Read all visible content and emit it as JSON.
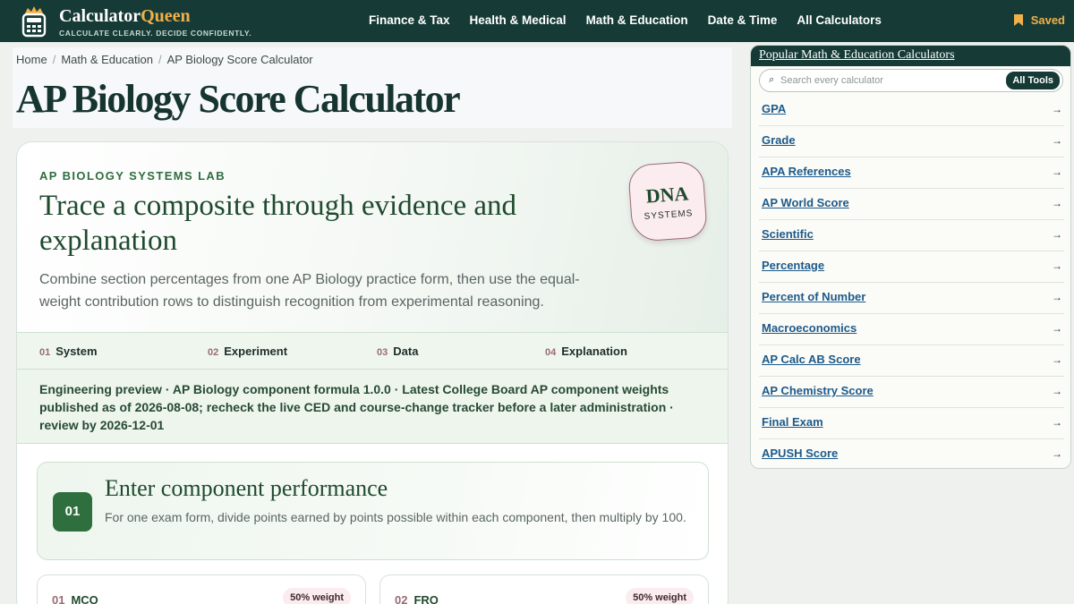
{
  "header": {
    "brand_name": "Calculator",
    "brand_accent": "Queen",
    "tagline": "CALCULATE CLEARLY. DECIDE CONFIDENTLY.",
    "nav": [
      "Finance & Tax",
      "Health & Medical",
      "Math & Education",
      "Date & Time",
      "All Calculators"
    ],
    "saved_label": "Saved"
  },
  "breadcrumb": [
    "Home",
    "Math & Education",
    "AP Biology Score Calculator"
  ],
  "page_title": "AP Biology Score Calculator",
  "hero": {
    "eyebrow": "AP BIOLOGY SYSTEMS LAB",
    "title": "Trace a composite through evidence and explanation",
    "description": "Combine section percentages from one AP Biology practice form, then use the equal-weight contribution rows to distinguish recognition from experimental reasoning.",
    "badge_big": "DNA",
    "badge_small": "SYSTEMS"
  },
  "steps": [
    {
      "num": "01",
      "label": "System"
    },
    {
      "num": "02",
      "label": "Experiment"
    },
    {
      "num": "03",
      "label": "Data"
    },
    {
      "num": "04",
      "label": "Explanation"
    }
  ],
  "preview_note": "Engineering preview · AP Biology component formula 1.0.0 · Latest College Board AP component weights published as of 2026-08-08; recheck the live CED and course-change tracker before a later administration · review by 2026-12-01",
  "section": {
    "num": "01",
    "title": "Enter component performance",
    "description": "For one exam form, divide points earned by points possible within each component, then multiply by 100."
  },
  "components": [
    {
      "num": "01",
      "label": "MCQ",
      "weight": "50% weight"
    },
    {
      "num": "02",
      "label": "FRQ",
      "weight": "50% weight"
    }
  ],
  "sidebar": {
    "title": "Popular Math & Education Calculators",
    "search_placeholder": "Search every calculator",
    "all_tools_label": "All Tools",
    "links": [
      "GPA",
      "Grade",
      "APA References",
      "AP World Score",
      "Scientific",
      "Percentage",
      "Percent of Number",
      "Macroeconomics",
      "AP Calc AB Score",
      "AP Chemistry Score",
      "Final Exam",
      "APUSH Score"
    ],
    "arrow": "→"
  },
  "colors": {
    "header_bg": "#163b36",
    "accent_gold": "#f0b04a",
    "green": "#2f6e3d",
    "link_blue": "#1d5a8a",
    "pink": "#fbecef"
  }
}
